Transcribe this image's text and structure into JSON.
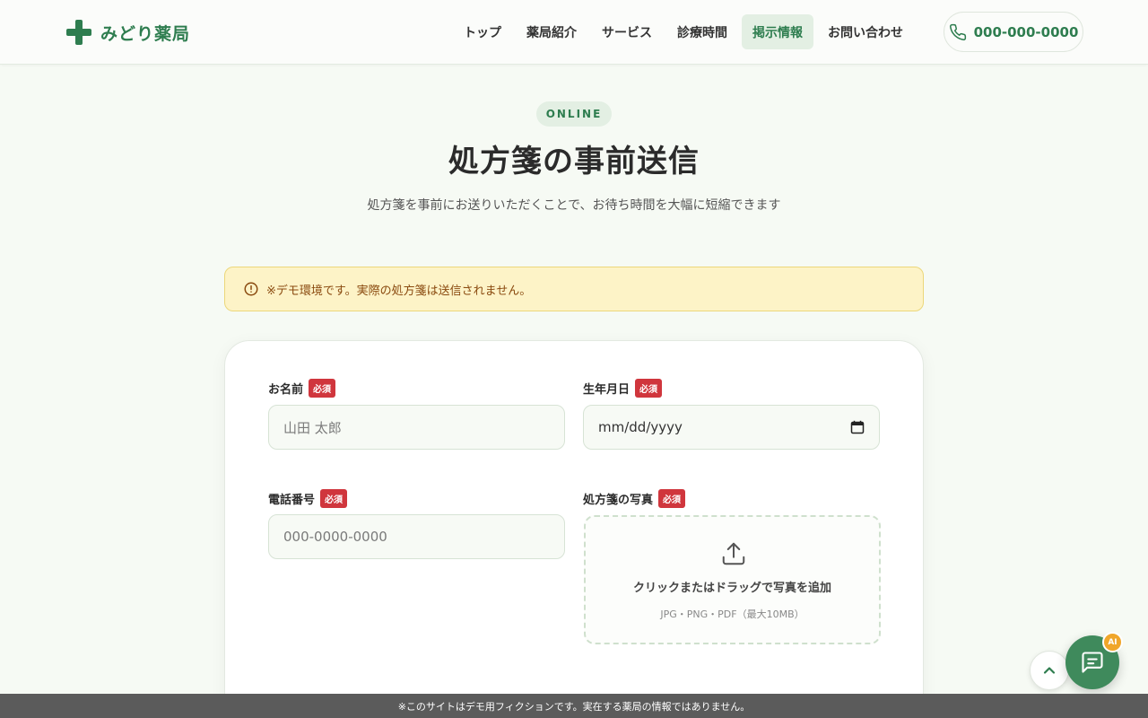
{
  "brand": {
    "name": "みどり薬局"
  },
  "nav": {
    "items": [
      {
        "label": "トップ"
      },
      {
        "label": "薬局紹介"
      },
      {
        "label": "サービス"
      },
      {
        "label": "診療時間"
      },
      {
        "label": "掲示情報",
        "active": true
      },
      {
        "label": "お問い合わせ"
      }
    ],
    "phone": "000-000-0000"
  },
  "hero": {
    "badge": "ONLINE",
    "title": "処方箋の事前送信",
    "subtitle": "処方箋を事前にお送りいただくことで、お待ち時間を大幅に短縮できます"
  },
  "notice": {
    "text": "※デモ環境です。実際の処方箋は送信されません。"
  },
  "form": {
    "required_label": "必須",
    "name": {
      "label": "お名前",
      "placeholder": "山田 太郎"
    },
    "birthdate": {
      "label": "生年月日",
      "placeholder": "mm/dd/yyyy"
    },
    "phone": {
      "label": "電話番号",
      "placeholder": "000-0000-0000"
    },
    "photo": {
      "label": "処方箋の写真",
      "upload_text": "クリックまたはドラッグで写真を追加",
      "formats": "JPG・PNG・PDF（最大10MB）"
    }
  },
  "chat": {
    "badge": "AI"
  },
  "footer": {
    "demo_notice": "※このサイトはデモ用フィクションです。実在する薬局の情報ではありません。"
  },
  "colors": {
    "brand": "#2e7d4f",
    "required": "#d0363d",
    "notice_bg": "#fdf3c7",
    "notice_text": "#8a4a0f",
    "chat": "#3f8a5c",
    "ai_badge": "#f0a62a"
  }
}
